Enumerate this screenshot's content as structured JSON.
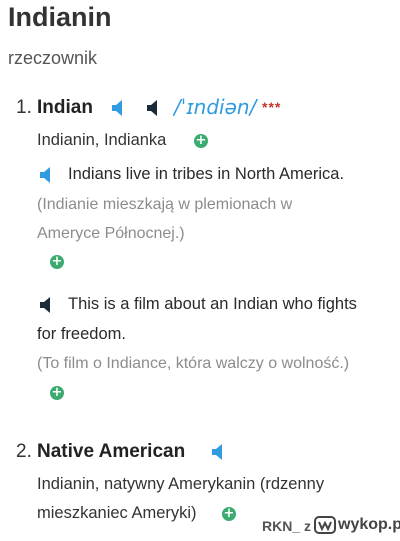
{
  "entry": {
    "headword": "Indianin",
    "part_of_speech": "rzeczownik"
  },
  "senses": [
    {
      "number": "1.",
      "term": "Indian",
      "pronunciation": "/ˈɪndiən/",
      "rating": "***",
      "translations": "Indianin, Indianka",
      "examples": [
        {
          "lines": [
            "Indians live in tribes in North America."
          ],
          "translation_lines": [
            "(Indianie mieszkają w plemionach w",
            "Ameryce Północnej.)"
          ]
        },
        {
          "lines": [
            "This is a film about an Indian who fights",
            "for freedom."
          ],
          "translation_lines": [
            "(To film o Indiance, która walczy o wolność.)"
          ]
        }
      ]
    },
    {
      "number": "2.",
      "term": "Native American",
      "translation_lines": [
        "Indianin, natywny Amerykanin (rdzenny",
        "mieszkaniec Ameryki)"
      ]
    }
  ],
  "icons": {
    "speaker": "speaker-icon",
    "add": "plus-circle-icon"
  },
  "colors": {
    "speaker_blue": "#2f9be0",
    "speaker_dark": "#1a2c3c",
    "add_green": "#3cab70",
    "ipa_blue": "#2f9be0",
    "stars_red": "#c0392b",
    "translation_gray": "#8c8c8c"
  },
  "watermark": {
    "user": "RKN_ z",
    "site": "wykop.pl"
  }
}
